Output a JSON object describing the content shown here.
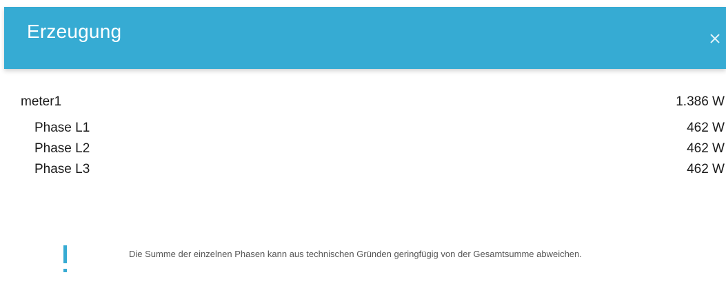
{
  "dialog": {
    "title": "Erzeugung",
    "close_icon": "close-icon",
    "accent_color": "#36abd3"
  },
  "meter": {
    "name": "meter1",
    "total": "1.386 W",
    "phases": [
      {
        "label": "Phase L1",
        "value": "462 W"
      },
      {
        "label": "Phase L2",
        "value": "462 W"
      },
      {
        "label": "Phase L3",
        "value": "462 W"
      }
    ]
  },
  "note": {
    "icon": "exclamation-icon",
    "text": "Die Summe der einzelnen Phasen kann aus technischen Gründen geringfügig von der Gesamtsumme abweichen."
  }
}
